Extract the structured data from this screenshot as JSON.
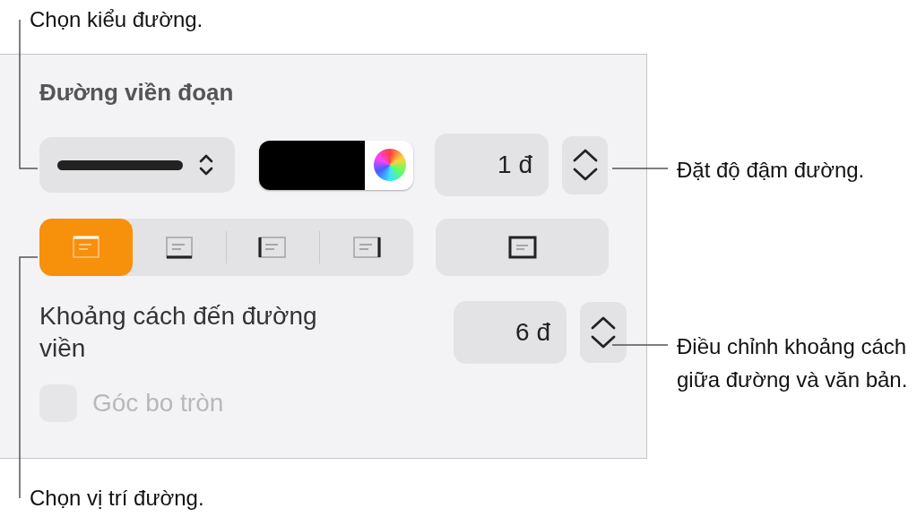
{
  "panel": {
    "title": "Đường viền đoạn",
    "weight": {
      "value": "1 đ"
    },
    "positions": [
      {
        "kind": "top",
        "selected": true
      },
      {
        "kind": "bottom",
        "selected": false
      },
      {
        "kind": "left",
        "selected": false
      },
      {
        "kind": "right",
        "selected": false
      }
    ],
    "all_sides": {
      "selected": false
    },
    "spacing": {
      "label": "Khoảng cách đến đường viền",
      "value": "6 đ"
    },
    "rounded_corners": {
      "label": "Góc bo tròn",
      "checked": false,
      "disabled": true
    }
  },
  "callouts": [
    {
      "text": "Chọn kiểu đường."
    },
    {
      "text": "Đặt độ đậm đường."
    },
    {
      "text": "Điều chỉnh khoảng cách giữa đường và văn bản."
    },
    {
      "text": "Chọn vị trí đường."
    }
  ]
}
